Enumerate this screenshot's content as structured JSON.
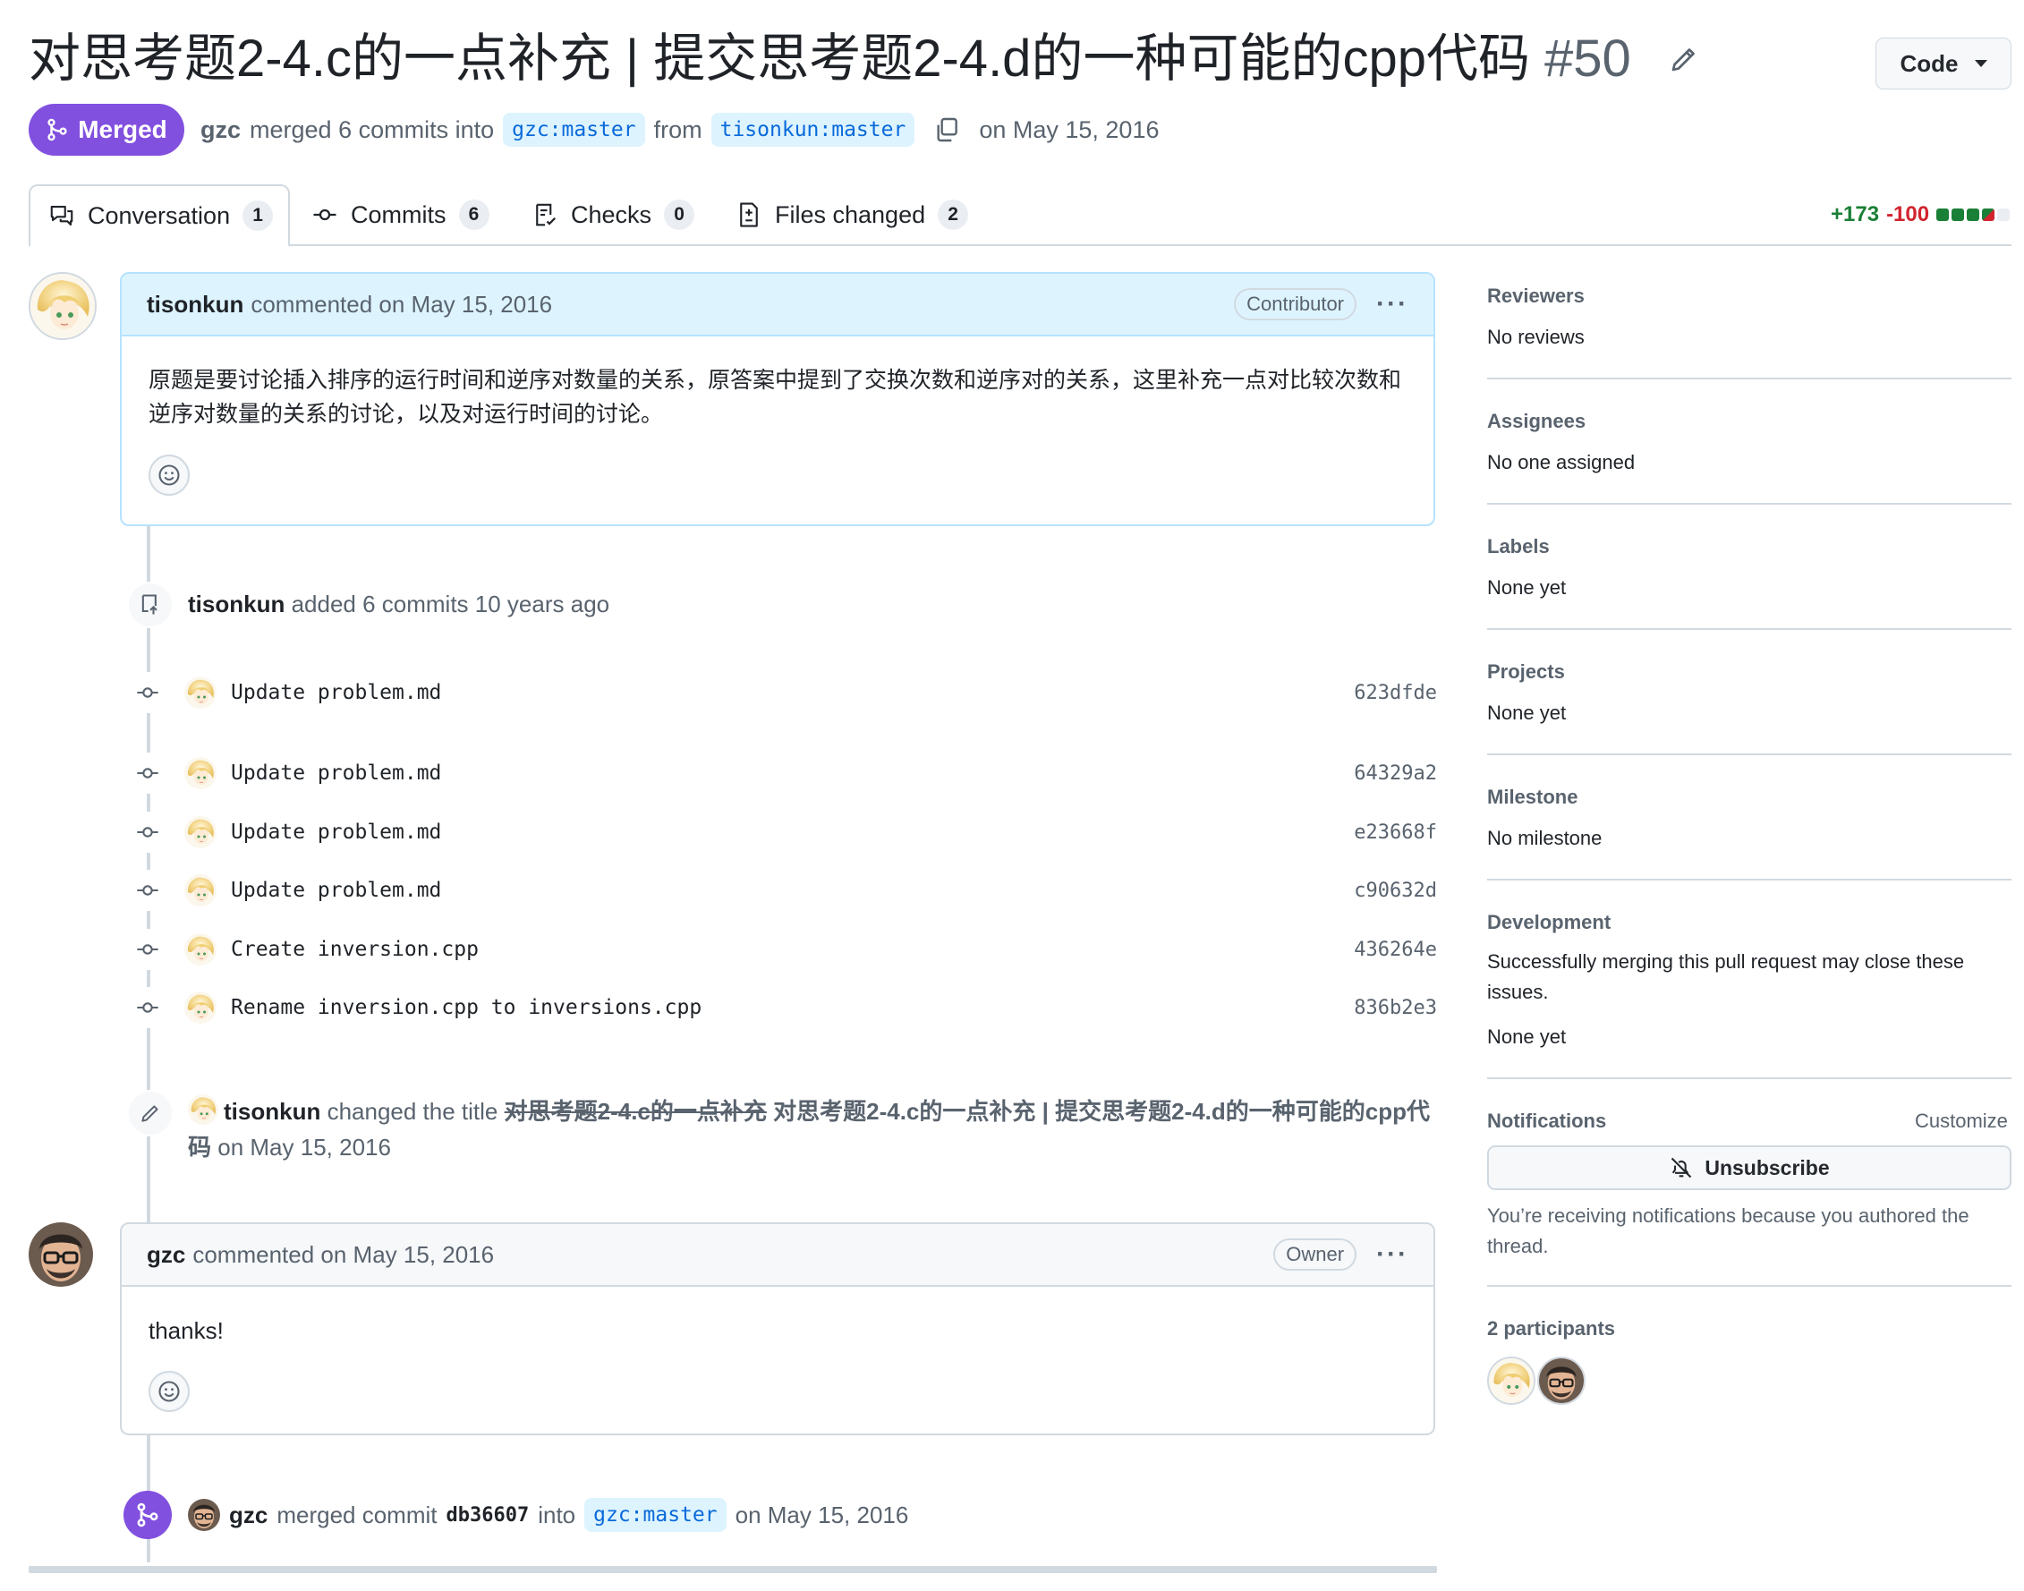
{
  "header": {
    "title": "对思考题2-4.c的一点补充 | 提交思考题2-4.d的一种可能的cpp代码",
    "number": "#50",
    "code_button": "Code",
    "state_badge": "Merged",
    "author": "gzc",
    "merged_text": "merged 6 commits into",
    "base_branch": "gzc:master",
    "from_text": "from",
    "head_branch": "tisonkun:master",
    "date_text": "on May 15, 2016"
  },
  "tabs": [
    {
      "label": "Conversation",
      "count": "1"
    },
    {
      "label": "Commits",
      "count": "6"
    },
    {
      "label": "Checks",
      "count": "0"
    },
    {
      "label": "Files changed",
      "count": "2"
    }
  ],
  "diffstat": {
    "additions": "+173",
    "deletions": "-100"
  },
  "comments": [
    {
      "author": "tisonkun",
      "action": "commented on May 15, 2016",
      "role": "Contributor",
      "body": "原题是要讨论插入排序的运行时间和逆序对数量的关系，原答案中提到了交换次数和逆序对的关系，这里补充一点对比较次数和逆序对数量的关系的讨论，以及对运行时间的讨论。"
    },
    {
      "author": "gzc",
      "action": "commented on May 15, 2016",
      "role": "Owner",
      "body": "thanks!"
    }
  ],
  "commits_event": {
    "author": "tisonkun",
    "text": "added 6 commits 10 years ago"
  },
  "commits": [
    {
      "message": "Update problem.md",
      "sha": "623dfde"
    },
    {
      "message": "Update problem.md",
      "sha": "64329a2"
    },
    {
      "message": "Update problem.md",
      "sha": "e23668f"
    },
    {
      "message": "Update problem.md",
      "sha": "c90632d"
    },
    {
      "message": "Create inversion.cpp",
      "sha": "436264e"
    },
    {
      "message": "Rename inversion.cpp to inversions.cpp",
      "sha": "836b2e3"
    }
  ],
  "title_change": {
    "author": "tisonkun",
    "text": "changed the title",
    "old_title": "对思考题2-4.c的一点补充",
    "new_title": "对思考题2-4.c的一点补充 | 提交思考题2-4.d的一种可能的cpp代码",
    "date": "on May 15, 2016"
  },
  "merge_event": {
    "author": "gzc",
    "text": "merged commit",
    "sha": "db36607",
    "into": "into",
    "branch": "gzc:master",
    "date": "on May 15, 2016"
  },
  "sidebar": {
    "reviewers": {
      "heading": "Reviewers",
      "value": "No reviews"
    },
    "assignees": {
      "heading": "Assignees",
      "value": "No one assigned"
    },
    "labels": {
      "heading": "Labels",
      "value": "None yet"
    },
    "projects": {
      "heading": "Projects",
      "value": "None yet"
    },
    "milestone": {
      "heading": "Milestone",
      "value": "No milestone"
    },
    "development": {
      "heading": "Development",
      "description": "Successfully merging this pull request may close these issues.",
      "value": "None yet"
    },
    "notifications": {
      "heading": "Notifications",
      "customize": "Customize",
      "unsubscribe": "Unsubscribe",
      "reason": "You’re receiving notifications because you authored the thread."
    },
    "participants": {
      "heading": "2 participants"
    }
  },
  "colors": {
    "merged": "#8250df",
    "additions": "#1a7f37",
    "deletions": "#d1242f",
    "branch_bg": "#ddf4ff",
    "branch_fg": "#0969da"
  },
  "icons": [
    "git-merge-icon",
    "copy-icon",
    "pencil-icon",
    "comment-discussion-icon",
    "git-commit-icon",
    "checklist-icon",
    "file-diff-icon",
    "repo-push-icon",
    "smiley-icon",
    "bell-slash-icon",
    "kebab-horizontal-icon",
    "triangle-down-icon"
  ]
}
